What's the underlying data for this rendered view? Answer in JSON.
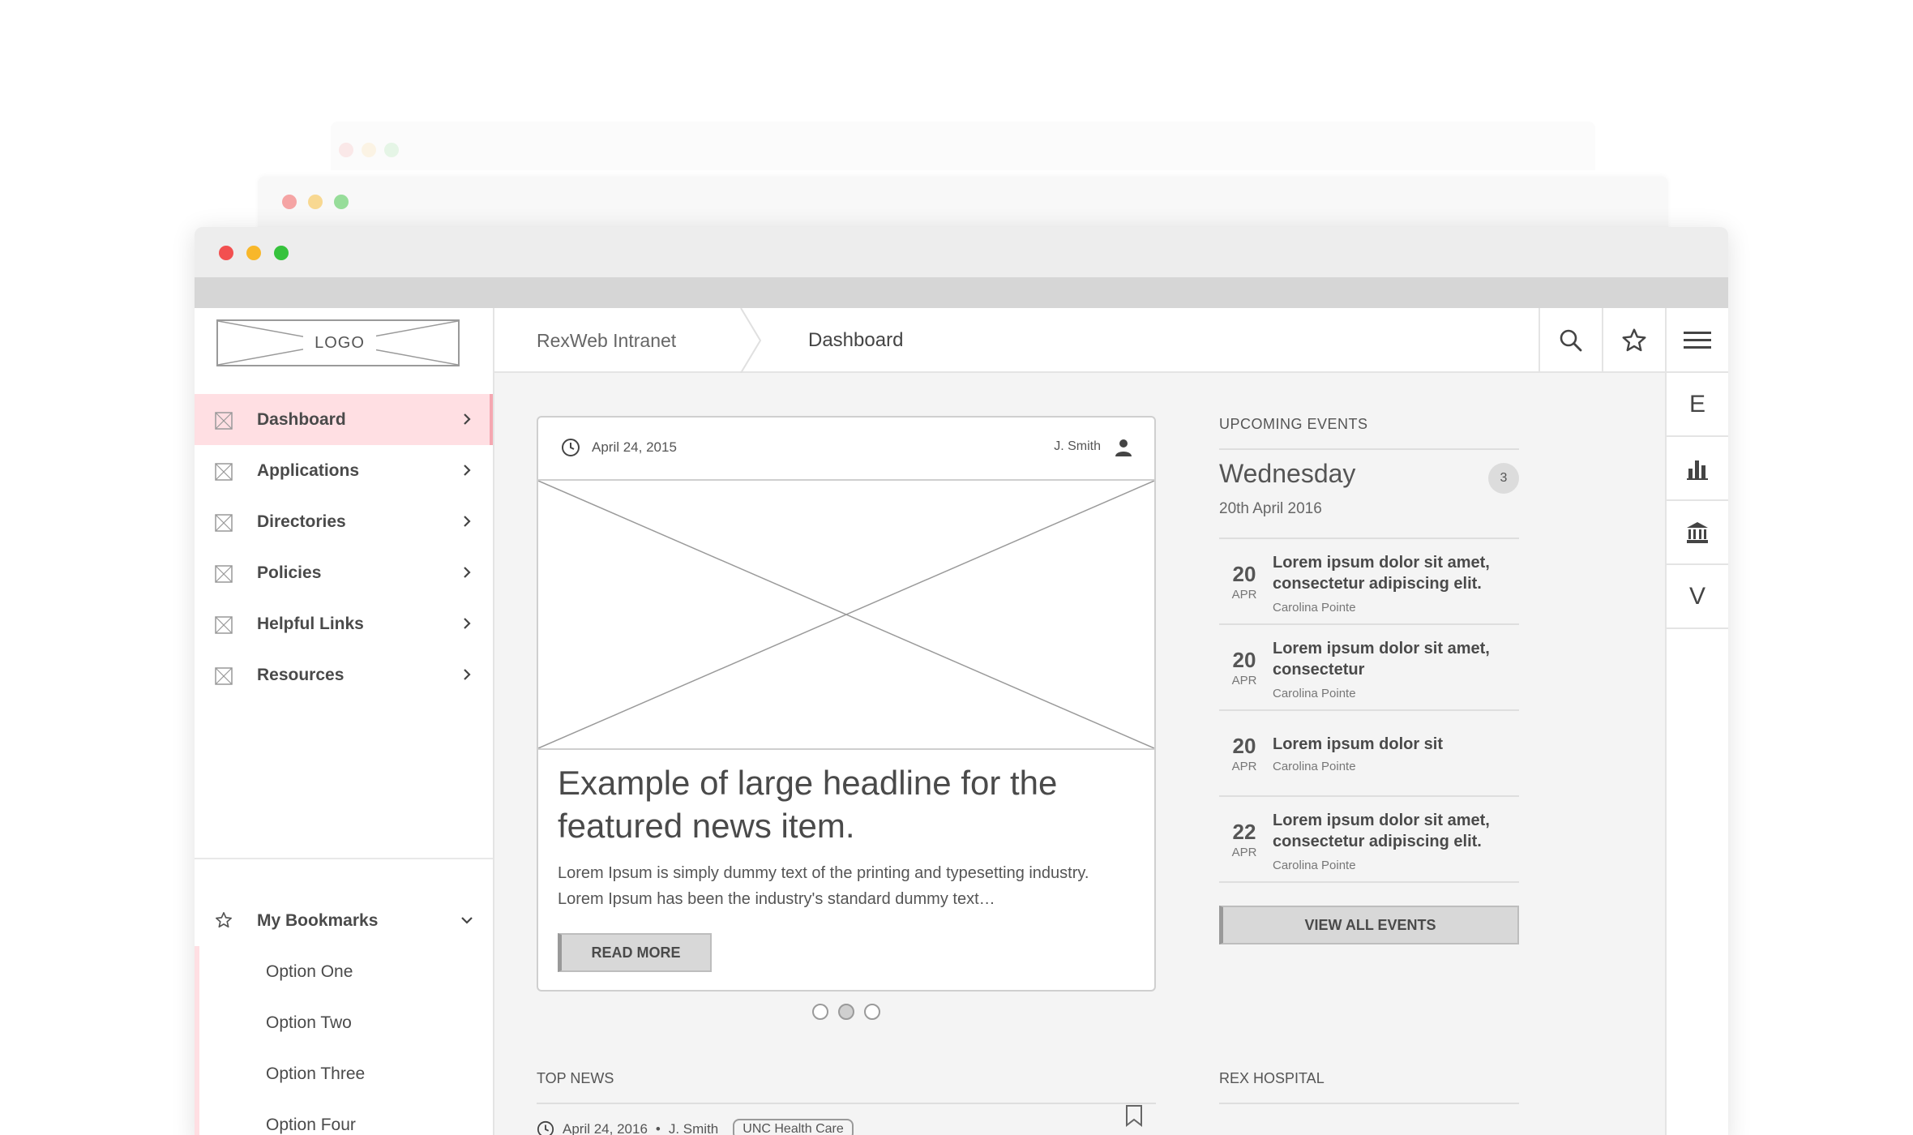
{
  "colors": {
    "close": "#f25050",
    "minimize": "#f8b72a",
    "maximize": "#36c23c",
    "active_nav": "#ffdfe3",
    "accent_bar": "#f5a7b1"
  },
  "logo": {
    "text": "LOGO"
  },
  "sidebar": {
    "items": [
      {
        "label": "Dashboard",
        "active": true
      },
      {
        "label": "Applications"
      },
      {
        "label": "Directories"
      },
      {
        "label": "Policies"
      },
      {
        "label": "Helpful Links"
      },
      {
        "label": "Resources"
      }
    ],
    "bookmarks": {
      "label": "My Bookmarks",
      "options": [
        "Option One",
        "Option Two",
        "Option Three",
        "Option Four"
      ]
    }
  },
  "header": {
    "breadcrumb_root": "RexWeb Intranet",
    "breadcrumb_current": "Dashboard",
    "icons": [
      "search-icon",
      "star-icon",
      "menu-icon"
    ]
  },
  "rail": {
    "items": [
      "E",
      "bar-chart-icon",
      "bank-icon",
      "V"
    ]
  },
  "featured": {
    "date": "April 24, 2015",
    "author": "J. Smith",
    "headline": "Example of large headline for the featured news item.",
    "body": "Lorem Ipsum is simply dummy text of the printing and typesetting industry. Lorem Ipsum has been the industry's standard dummy text…",
    "read_more": "READ MORE",
    "pager": {
      "count": 3,
      "active": 2
    }
  },
  "events": {
    "title": "UPCOMING EVENTS",
    "day": "Wednesday",
    "date": "20th April 2016",
    "count": "3",
    "items": [
      {
        "day": "20",
        "month": "APR",
        "title": "Lorem ipsum dolor sit amet, consectetur adipiscing elit.",
        "location": "Carolina Pointe"
      },
      {
        "day": "20",
        "month": "APR",
        "title": "Lorem ipsum dolor sit amet, consectetur",
        "location": "Carolina Pointe"
      },
      {
        "day": "20",
        "month": "APR",
        "title": "Lorem ipsum dolor sit",
        "location": "Carolina Pointe"
      },
      {
        "day": "22",
        "month": "APR",
        "title": "Lorem ipsum dolor sit amet, consectetur adipiscing elit.",
        "location": "Carolina Pointe"
      }
    ],
    "view_all": "VIEW ALL EVENTS"
  },
  "top_news": {
    "title": "TOP NEWS",
    "date": "April 24, 2016",
    "separator": "•",
    "author": "J. Smith",
    "tag": "UNC Health Care"
  },
  "rex_hospital": {
    "title": "REX HOSPITAL"
  }
}
